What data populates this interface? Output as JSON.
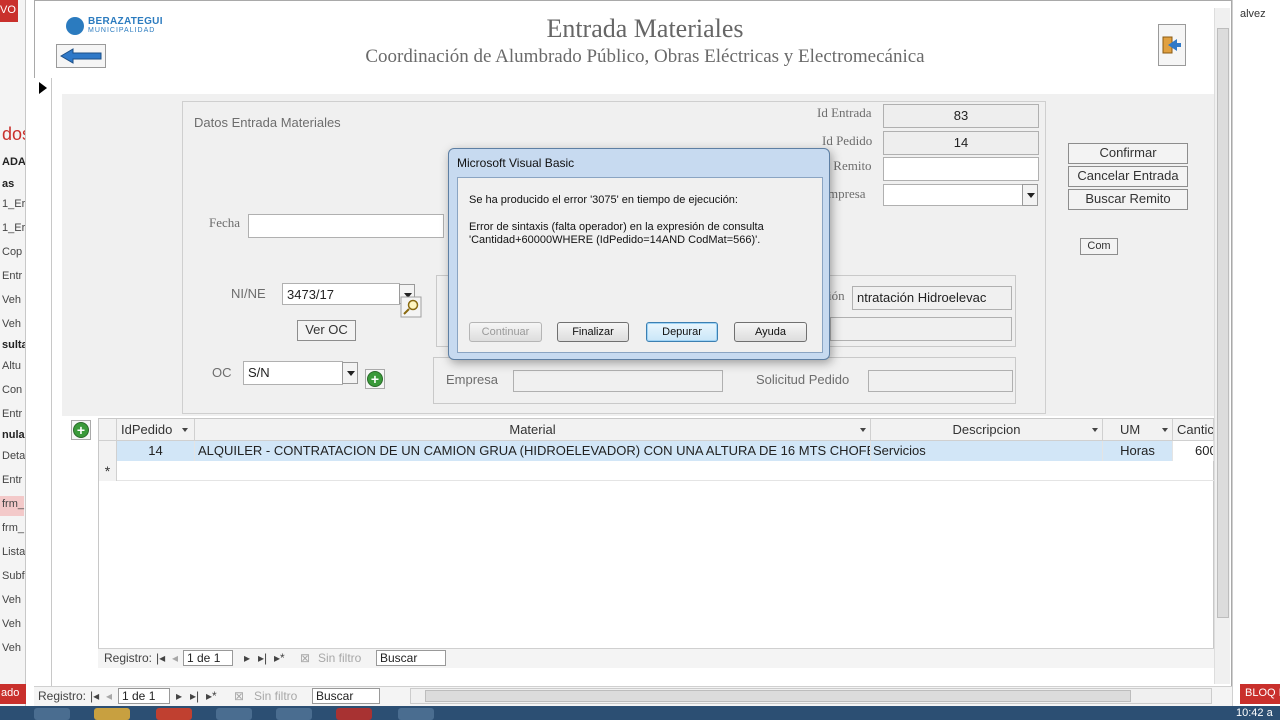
{
  "left_pane": {
    "top_tag": "VO",
    "items": [
      "dos",
      "ADA",
      "as",
      "1_Er",
      "1_Er",
      "Cop",
      "Entr",
      "Veh",
      "Veh",
      "sulta",
      "Altu",
      "Con",
      "Entr",
      "nula",
      "Deta",
      "Entr",
      "frm_",
      "frm_",
      "Lista",
      "Subf",
      "Veh",
      "Veh",
      "Veh"
    ],
    "status": "ado"
  },
  "header": {
    "logo_line1": "BERAZATEGUI",
    "logo_line2": "MUNICIPALIDAD",
    "title": "Entrada Materiales",
    "subtitle": "Coordinación de Alumbrado Público, Obras Eléctricas y Electromecánica",
    "back_icon": "arrow-left-icon",
    "exit_icon": "exit-door-icon"
  },
  "form": {
    "section_label": "Datos Entrada Materiales",
    "id_entrada_label": "Id Entrada",
    "id_entrada_value": "83",
    "id_pedido_label": "Id Pedido",
    "id_pedido_value": "14",
    "remito_label": "º Remito",
    "remito_value": "",
    "empresa_label": "mpresa",
    "empresa_value": "",
    "fecha_label": "Fecha",
    "fecha_value": "",
    "nine_label": "NI/NE",
    "nine_value": "3473/17",
    "ver_oc_label": "Ver OC",
    "oc_label": "OC",
    "oc_value": "S/N",
    "descripcion_label": "ión",
    "descripcion_value": "ntratación Hidroelevac",
    "empresa2_label": "Empresa",
    "empresa2_value": "",
    "solicitud_label": "Solicitud Pedido",
    "solicitud_value": ""
  },
  "actions": {
    "confirmar": "Confirmar",
    "cancelar": "Cancelar Entrada",
    "buscar_remito": "Buscar Remito",
    "com": "Com"
  },
  "grid": {
    "columns": [
      "IdPedido",
      "Material",
      "Descripcion",
      "UM",
      "Cantic"
    ],
    "rows": [
      {
        "idpedido": "14",
        "material": "ALQUILER - CONTRATACION DE UN CAMION GRUA (HIDROELEVADOR) CON UNA ALTURA DE 16 MTS CHOFER Y PEON",
        "descripcion": "Servicios",
        "um": "Horas",
        "cantidad": "600"
      }
    ],
    "new_row_marker": "*",
    "nav": {
      "label": "Registro:",
      "position": "1 de 1",
      "filter": "Sin filtro",
      "search": "Buscar"
    }
  },
  "form_nav": {
    "label": "Registro:",
    "position": "1 de 1",
    "filter": "Sin filtro",
    "search": "Buscar"
  },
  "right_edge": {
    "user": "alvez",
    "status": "BLOQ I"
  },
  "taskbar": {
    "clock": "10:42 a"
  },
  "dialog": {
    "title": "Microsoft Visual Basic",
    "message_line1": "Se ha producido el error '3075' en tiempo de ejecución:",
    "message_line2": "Error de sintaxis (falta operador) en la expresión de consulta",
    "message_line3": "'Cantidad+60000WHERE (IdPedido=14AND CodMat=566)'.",
    "buttons": {
      "continuar": "Continuar",
      "finalizar": "Finalizar",
      "depurar": "Depurar",
      "ayuda": "Ayuda"
    }
  }
}
